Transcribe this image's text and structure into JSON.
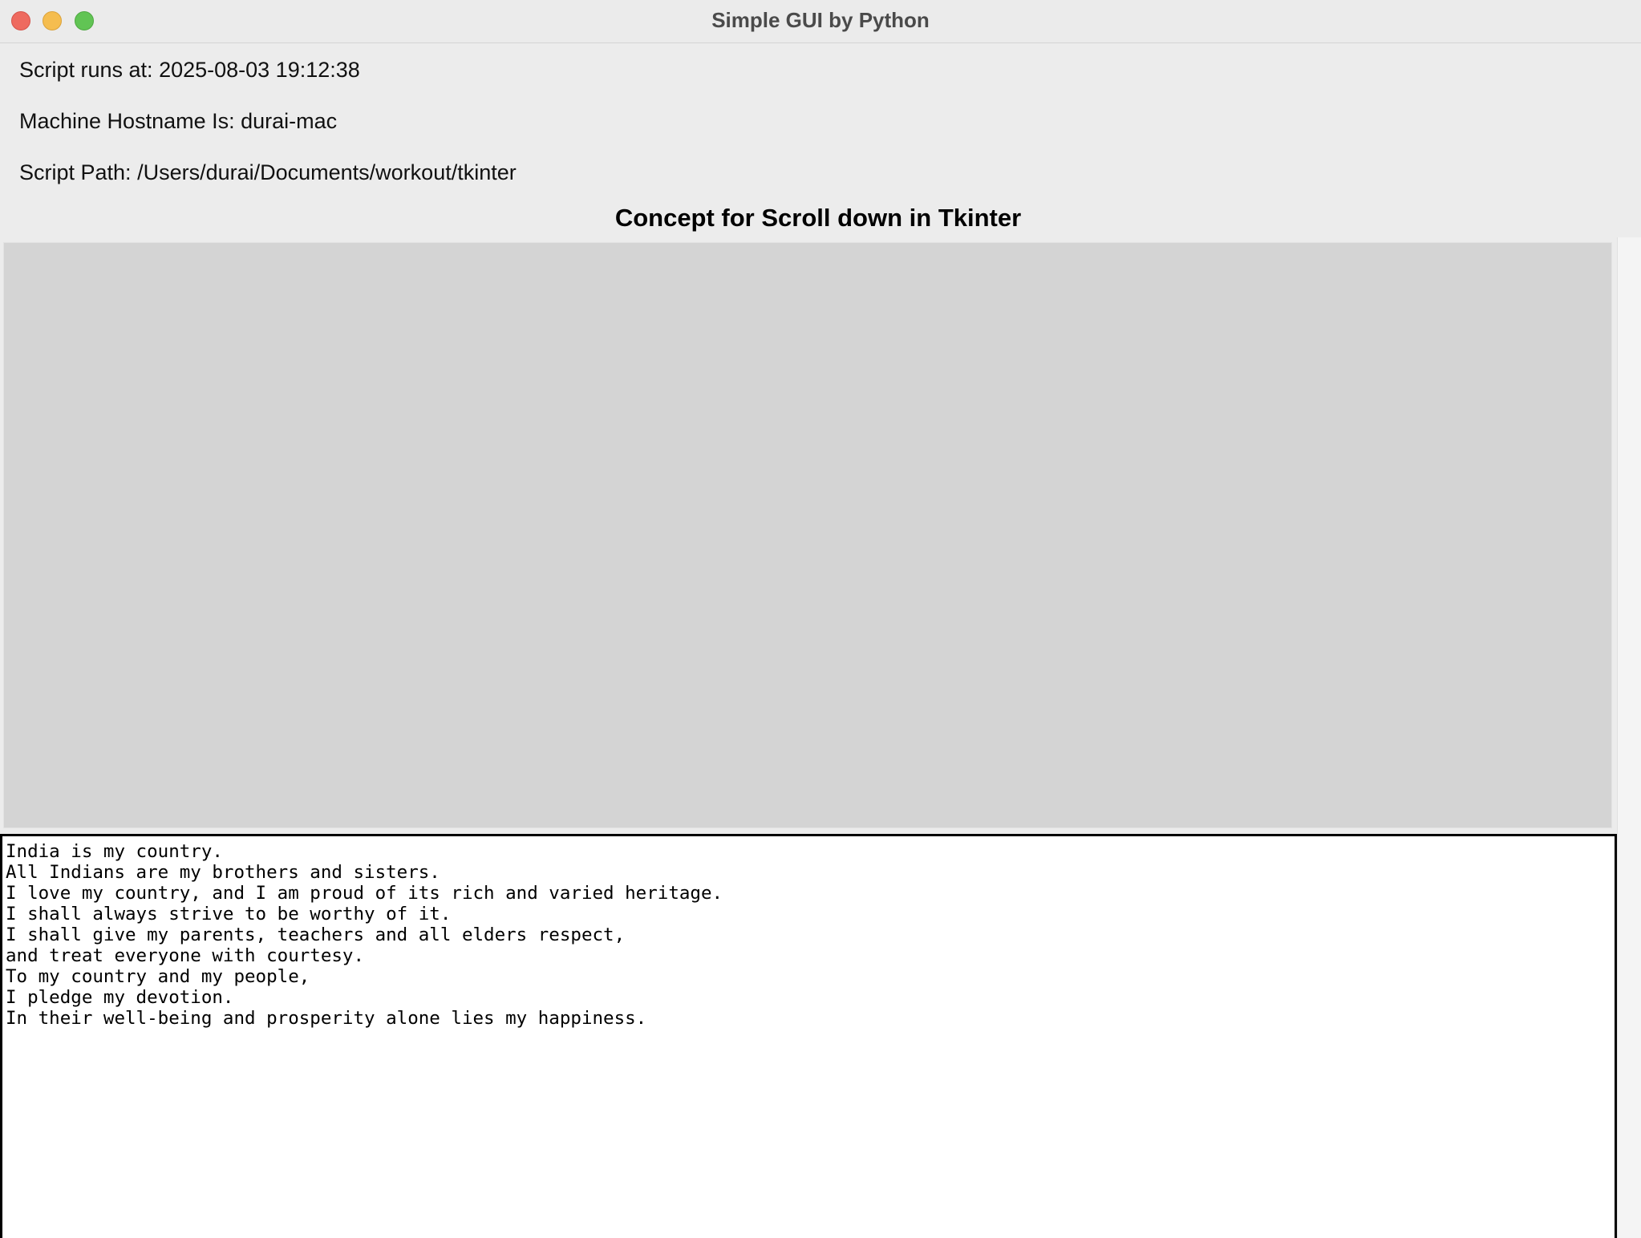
{
  "window": {
    "title": "Simple GUI by Python"
  },
  "info": {
    "runs_at": "Script runs at: 2025-08-03 19:12:38",
    "hostname": "Machine Hostname Is: durai-mac",
    "path": "Script Path: /Users/durai/Documents/workout/tkinter"
  },
  "heading": "Concept for Scroll down in Tkinter",
  "text_area": {
    "lines": [
      "India is my country.",
      "All Indians are my brothers and sisters.",
      "I love my country, and I am proud of its rich and varied heritage.",
      "I shall always strive to be worthy of it.",
      "I shall give my parents, teachers and all elders respect,",
      "and treat everyone with courtesy.",
      "To my country and my people,",
      "I pledge my devotion.",
      "In their well-being and prosperity alone lies my happiness."
    ]
  },
  "colors": {
    "close": "#ee6a5f",
    "minimize": "#f5bd4f",
    "zoom": "#61c454",
    "canvas": "#d4d4d4",
    "window_bg": "#ececec"
  }
}
